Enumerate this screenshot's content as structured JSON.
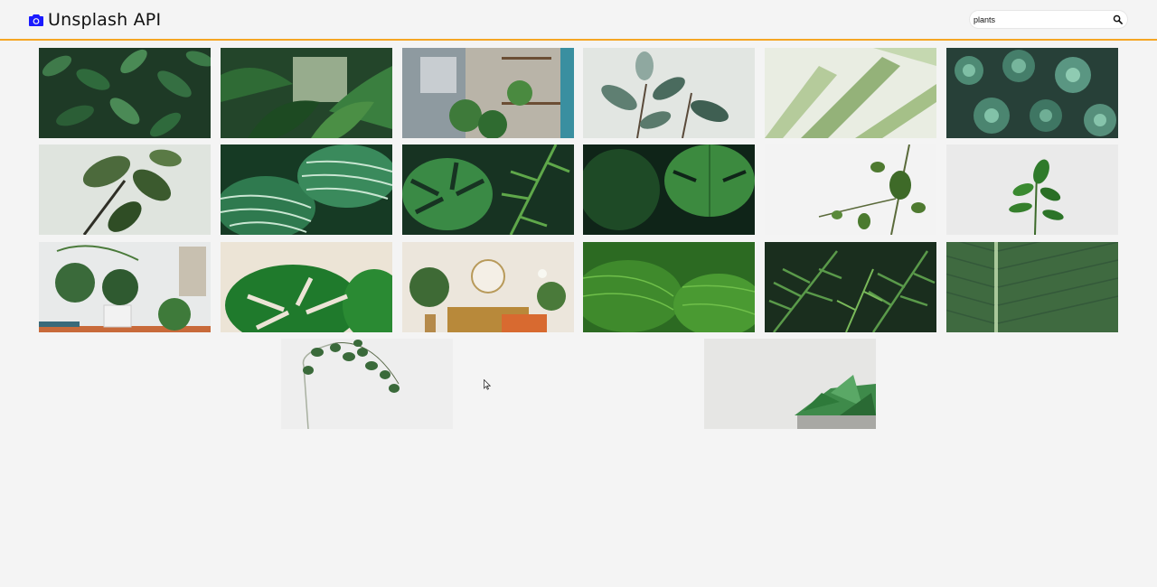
{
  "app": {
    "title": "Unsplash API"
  },
  "search": {
    "value": "plants",
    "placeholder": ""
  },
  "colors": {
    "accent": "#f5a623",
    "logo": "#1a1aff",
    "background": "#f4f4f4"
  },
  "icons": {
    "logo": "camera-icon",
    "search": "search-icon"
  },
  "photos": [
    {
      "name": "photo-dense-green-leaves"
    },
    {
      "name": "photo-tropical-jungle"
    },
    {
      "name": "photo-cafe-plants"
    },
    {
      "name": "photo-rubber-plant-stems"
    },
    {
      "name": "photo-blurred-palm-leaves"
    },
    {
      "name": "photo-succulent-rosettes"
    },
    {
      "name": "photo-fiddle-leaf-fig"
    },
    {
      "name": "photo-striped-calathea"
    },
    {
      "name": "photo-monstera-and-fern"
    },
    {
      "name": "photo-dark-monstera"
    },
    {
      "name": "photo-eucalyptus-sprig"
    },
    {
      "name": "photo-small-plant-sprig"
    },
    {
      "name": "photo-houseplant-shelf"
    },
    {
      "name": "photo-monstera-leaf-beige"
    },
    {
      "name": "photo-modern-living-room"
    },
    {
      "name": "photo-green-leaf-closeup"
    },
    {
      "name": "photo-palm-fronds"
    },
    {
      "name": "photo-leaf-texture"
    },
    {
      "name": "photo-hanging-eucalyptus"
    },
    {
      "name": "photo-succulent-in-pot"
    }
  ]
}
